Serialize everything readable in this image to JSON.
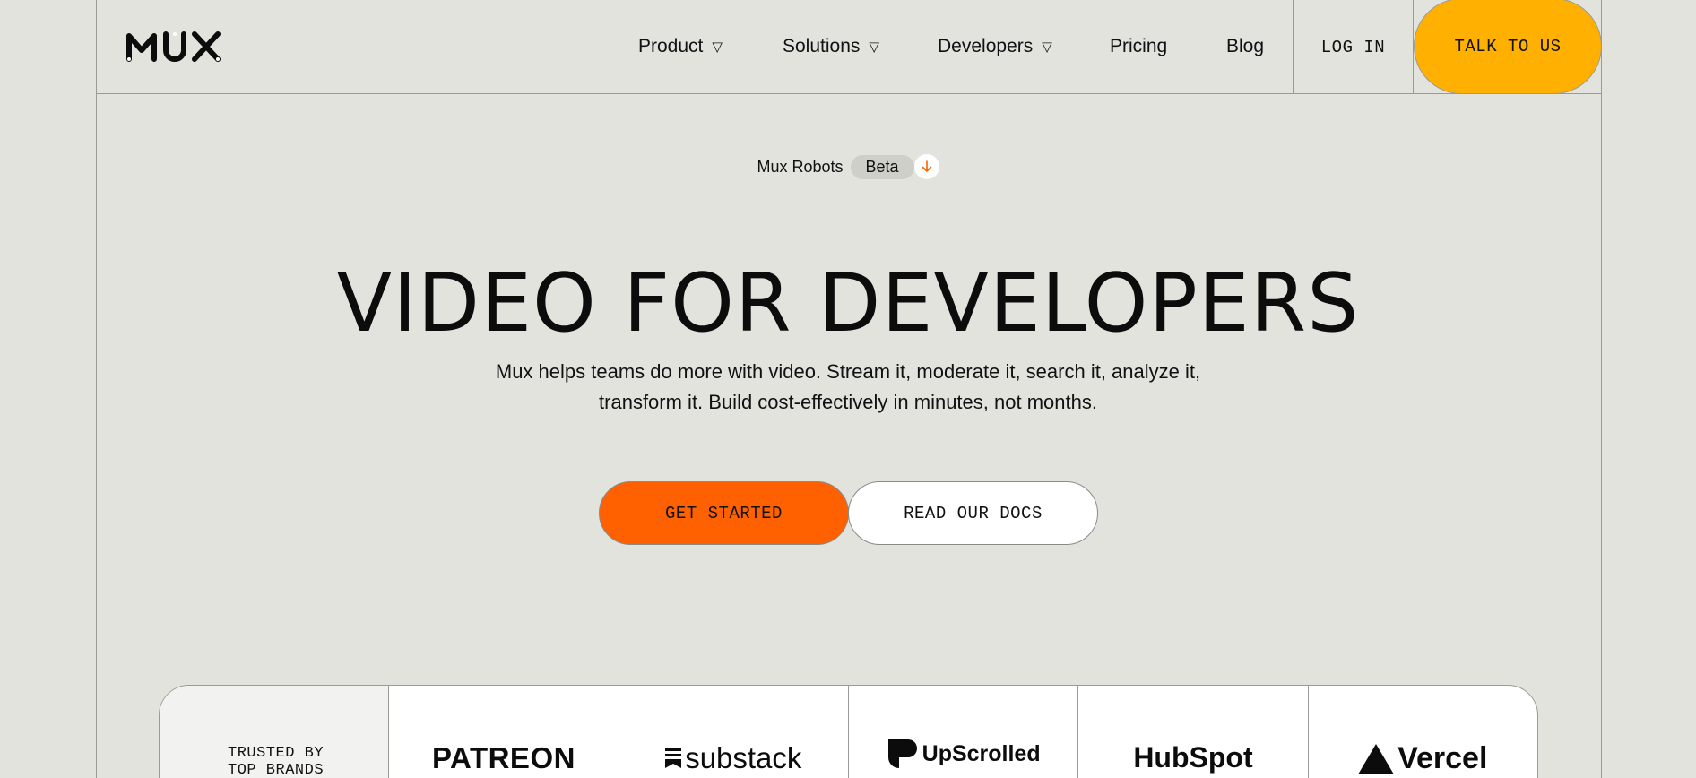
{
  "nav": {
    "logo": "MUX",
    "items": [
      {
        "label": "Product",
        "has_caret": true
      },
      {
        "label": "Solutions",
        "has_caret": true
      },
      {
        "label": "Developers",
        "has_caret": true
      },
      {
        "label": "Pricing",
        "has_caret": false
      },
      {
        "label": "Blog",
        "has_caret": false
      }
    ],
    "caret": "▽",
    "login": "LOG IN",
    "talk": "TALK TO US"
  },
  "announcement": {
    "text": "Mux Robots",
    "badge": "Beta",
    "icon": "arrow-down-icon"
  },
  "hero": {
    "title": "VIDEO FOR DEVELOPERS",
    "subtitle_line1": "Mux helps teams do more with video. Stream it, moderate it, search it, analyze it,",
    "subtitle_line2": "transform it. Build cost-effectively in minutes, not months.",
    "primary_cta": "GET STARTED",
    "secondary_cta": "READ OUR DOCS"
  },
  "brands": {
    "label_line1": "TRUSTED BY",
    "label_line2": "TOP BRANDS",
    "logos": [
      "PATREON",
      "substack",
      "UpScrolled",
      "HubSpot",
      "Vercel"
    ]
  },
  "colors": {
    "background": "#e3e3de",
    "accent_orange": "#ff6101",
    "accent_yellow": "#ffb000"
  }
}
